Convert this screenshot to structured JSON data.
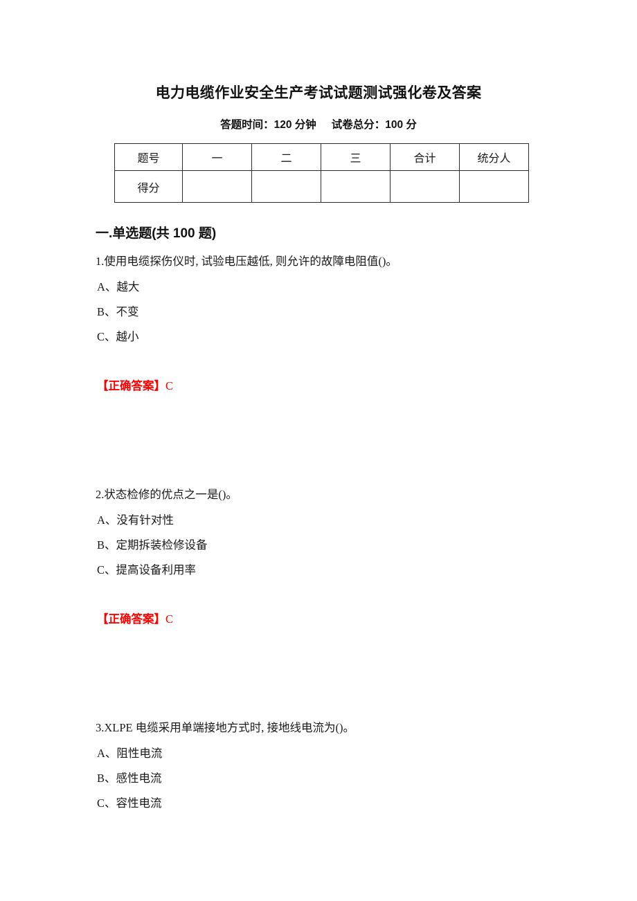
{
  "document": {
    "title": "电力电缆作业安全生产考试试题测试强化卷及答案",
    "subtitle_time": "答题时间：120 分钟",
    "subtitle_score": "试卷总分：100 分",
    "answer_color": "#ff0000",
    "text_color": "#1a1a1a",
    "background_color": "#ffffff"
  },
  "score_table": {
    "header": [
      "题号",
      "一",
      "二",
      "三",
      "合计",
      "统分人"
    ],
    "rows": [
      {
        "label": "得分",
        "cells": [
          "",
          "",
          "",
          "",
          ""
        ]
      }
    ]
  },
  "sections": [
    {
      "heading": "一.单选题(共 100 题)",
      "questions": [
        {
          "stem": "1.使用电缆探伤仪时, 试验电压越低, 则允许的故障电阻值()。",
          "options": [
            "A、越大",
            "B、不变",
            "C、越小"
          ],
          "answer_label": "【正确答案】",
          "answer_value": "C"
        },
        {
          "stem": "2.状态检修的优点之一是()。",
          "options": [
            "A、没有针对性",
            "B、定期拆装检修设备",
            "C、提高设备利用率"
          ],
          "answer_label": "【正确答案】",
          "answer_value": "C"
        },
        {
          "stem": "3.XLPE 电缆采用单端接地方式时, 接地线电流为()。",
          "options": [
            "A、阻性电流",
            "B、感性电流",
            "C、容性电流"
          ],
          "answer_label": "",
          "answer_value": ""
        }
      ]
    }
  ]
}
